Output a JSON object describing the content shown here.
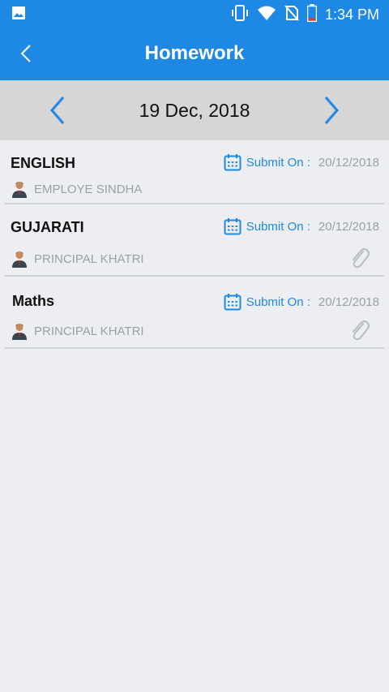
{
  "status_bar": {
    "time": "1:34 PM",
    "icons": [
      "image-icon",
      "vibrate-icon",
      "wifi-icon",
      "no-sim-icon",
      "battery-icon"
    ]
  },
  "app_bar": {
    "title": "Homework",
    "back_icon": "chevron-left-icon"
  },
  "date_nav": {
    "date": "19 Dec, 2018",
    "prev_icon": "chevron-left-icon",
    "next_icon": "chevron-right-icon"
  },
  "homework": [
    {
      "subject": "ENGLISH",
      "submit_label": "Submit On :",
      "submit_date": "20/12/2018",
      "teacher": "EMPLOYE SINDHA",
      "attachment": false
    },
    {
      "subject": "GUJARATI",
      "submit_label": "Submit On :",
      "submit_date": "20/12/2018",
      "teacher": "PRINCIPAL KHATRI",
      "attachment": true
    },
    {
      "subject": "Maths",
      "submit_label": "Submit On :",
      "submit_date": "20/12/2018",
      "teacher": "PRINCIPAL KHATRI",
      "attachment": true
    }
  ],
  "colors": {
    "primary": "#1e88e5",
    "date_bar": "#d6d6d6",
    "background": "#eceef1",
    "muted_text": "#9aa0a6"
  }
}
